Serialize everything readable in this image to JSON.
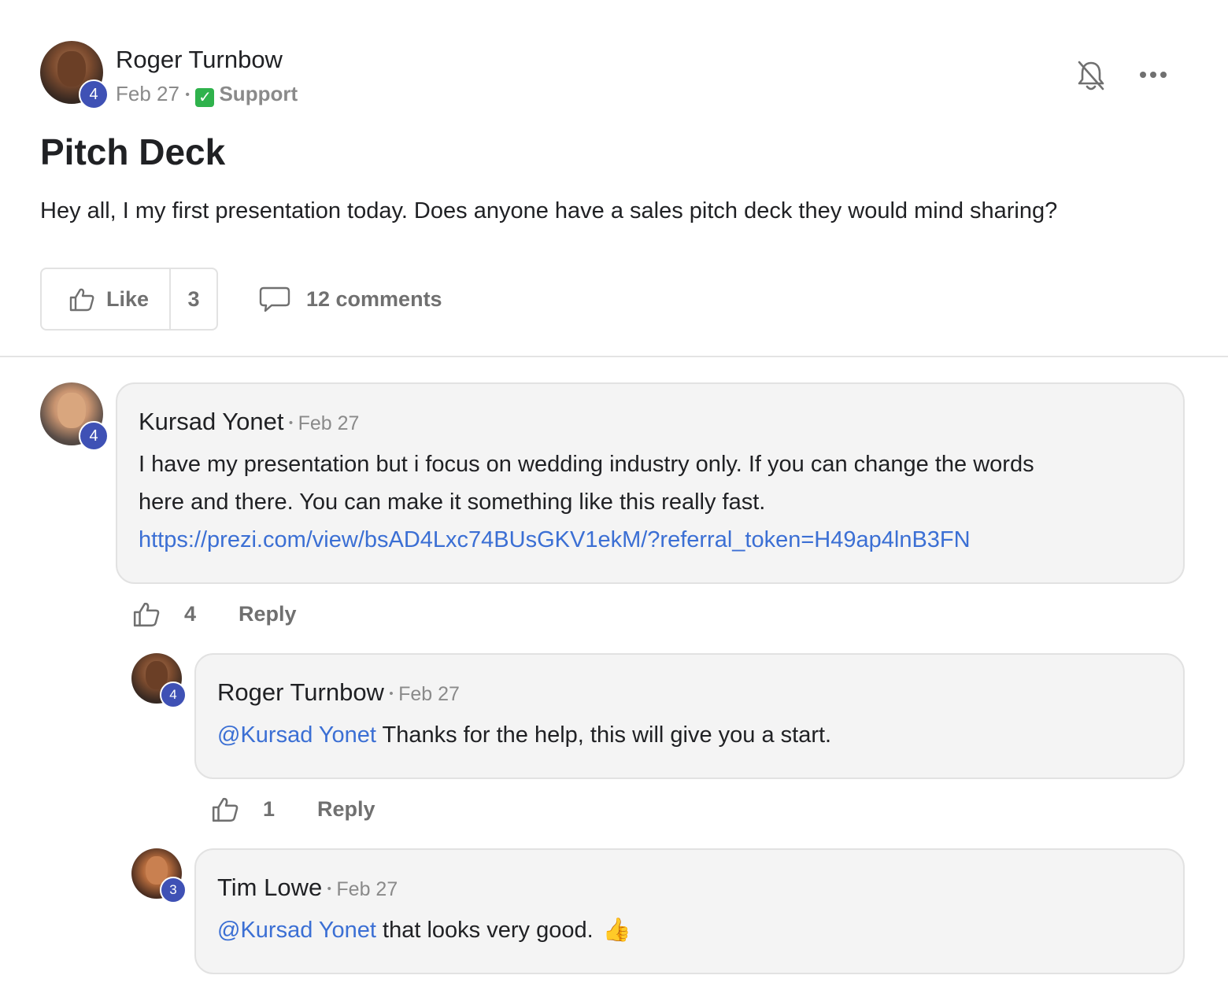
{
  "post": {
    "author": {
      "name": "Roger Turnbow",
      "level": "4"
    },
    "date": "Feb 27",
    "separator": "•",
    "category": {
      "label": "Support",
      "icon": "check-mark-icon",
      "icon_color": "#2fb24c"
    },
    "title": "Pitch Deck",
    "body": "Hey all, I my first presentation today. Does anyone have a sales pitch deck they would mind sharing?",
    "like_label": "Like",
    "like_count": "3",
    "comments_label": "12 comments"
  },
  "header_icons": [
    "bell-off-icon",
    "more-horizontal-icon"
  ],
  "comments": [
    {
      "author": "Kursad Yonet",
      "level": "4",
      "separator": "•",
      "date": "Feb 27",
      "text_line1": "I have my presentation but i focus on wedding industry only. If you can change the words",
      "text_line2": "here and there. You can make it something like this really fast.",
      "link": "https://prezi.com/view/bsAD4Lxc74BUsGKV1ekM/?referral_token=H49ap4lnB3FN",
      "likes": "4",
      "reply_label": "Reply",
      "replies": [
        {
          "author": "Roger Turnbow",
          "level": "4",
          "separator": "•",
          "date": "Feb 27",
          "mention": "@Kursad Yonet",
          "text": " Thanks for the help, this will give you a start.",
          "likes": "1",
          "reply_label": "Reply"
        },
        {
          "author": "Tim Lowe",
          "level": "3",
          "separator": "•",
          "date": "Feb 27",
          "mention": "@Kursad Yonet",
          "text": " that looks very good.",
          "emoji": "👍"
        }
      ]
    }
  ],
  "colors": {
    "accent_link": "#3b6fd4",
    "level_badge": "#3f51b5",
    "bubble_bg": "#f4f4f4",
    "muted_text": "#707070"
  }
}
